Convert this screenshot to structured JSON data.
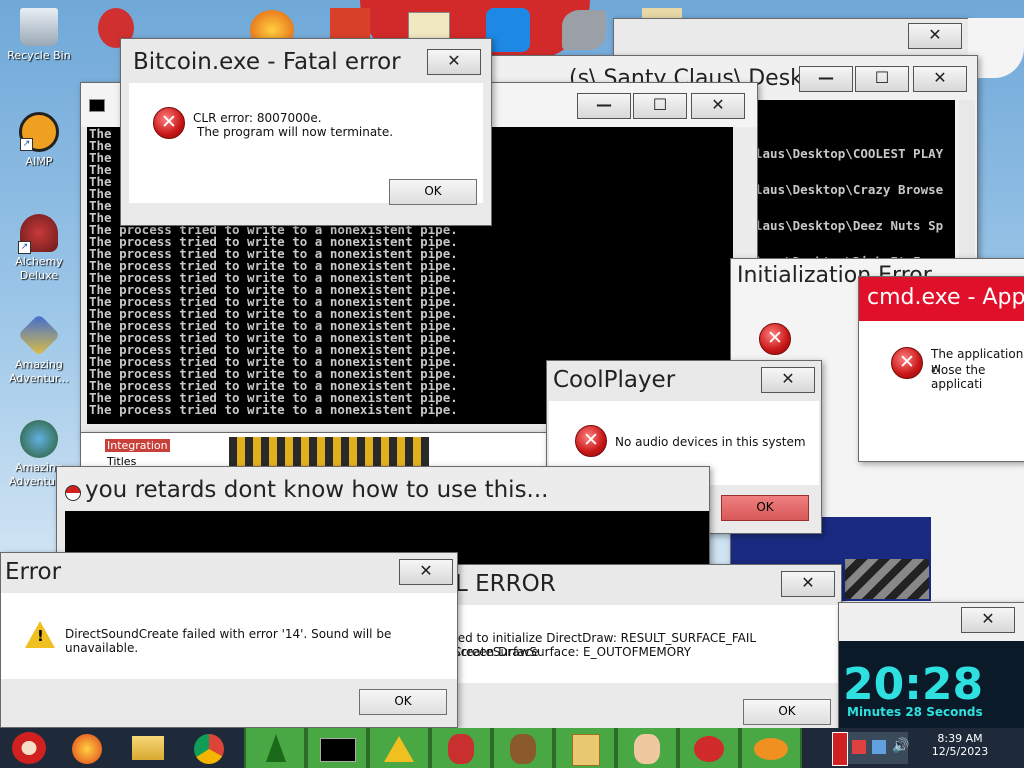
{
  "desktop": {
    "icons": [
      {
        "label": "Recycle Bin",
        "icon": "recycle-bin-icon"
      },
      {
        "label": "AIMP",
        "icon": "aimp-icon"
      },
      {
        "label": "Alchemy Deluxe",
        "icon": "alchemy-icon"
      },
      {
        "label": "Amazing Adventur...",
        "icon": "amazing-adventures-icon"
      },
      {
        "label": "Amazing Adventur...",
        "icon": "amazing-adventures-2-icon"
      }
    ]
  },
  "windows": {
    "bitcoin": {
      "title": "Bitcoin.exe - Fatal error",
      "line1": "CLR error: 8007000e.",
      "line2": "The program will now terminate.",
      "ok": "OK",
      "close": "✕"
    },
    "console": {
      "title_partial": "(s\\ Santy Claus\\ Desk...",
      "console_line": "The process tried to write to a nonexistent pipe.",
      "line_count": 16,
      "partial_top": "The",
      "min": "—",
      "max": "☐",
      "close": "✕"
    },
    "rightconsole": {
      "lines": [
        "laus\\Desktop\\COOLEST PLAY",
        "laus\\Desktop\\Crazy Browse",
        "laus\\Desktop\\Deez Nuts Sp",
        "laus\\Desktop\\Dick It Easy"
      ],
      "min": "—",
      "max": "☐",
      "close": "✕"
    },
    "init": {
      "title": "Initialization Error"
    },
    "cmd": {
      "title": "cmd.exe - Appl",
      "line1": "The application w",
      "line2": "close the applicati"
    },
    "coolplayer": {
      "title": "CoolPlayer",
      "message": "No audio devices in this system",
      "ok": "OK",
      "close": "✕"
    },
    "retards": {
      "title": "you retards dont know how to use this...",
      "close": "✕"
    },
    "error": {
      "title": "Error",
      "message": "DirectSoundCreate failed with error '14'.  Sound will be unavailable.",
      "ok": "OK",
      "close": "✕"
    },
    "ddraw": {
      "title": "L ERROR",
      "line1": "ted to initialize DirectDraw: RESULT_SURFACE_FAIL CreateSurface",
      "line2": "Screen DrawSurface: E_OUTOFMEMORY",
      "ok": "OK",
      "close": "✕"
    },
    "clock": {
      "time": "20:28",
      "caption": "Minutes 28 Seconds",
      "close": "✕"
    },
    "tree": {
      "selected": "Integration",
      "item2": "Titles"
    }
  },
  "taskbar": {
    "time": "8:39 AM",
    "date": "12/5/2023",
    "colors": {
      "bar": "#1e2a3a",
      "app_green": "#49a844"
    }
  }
}
